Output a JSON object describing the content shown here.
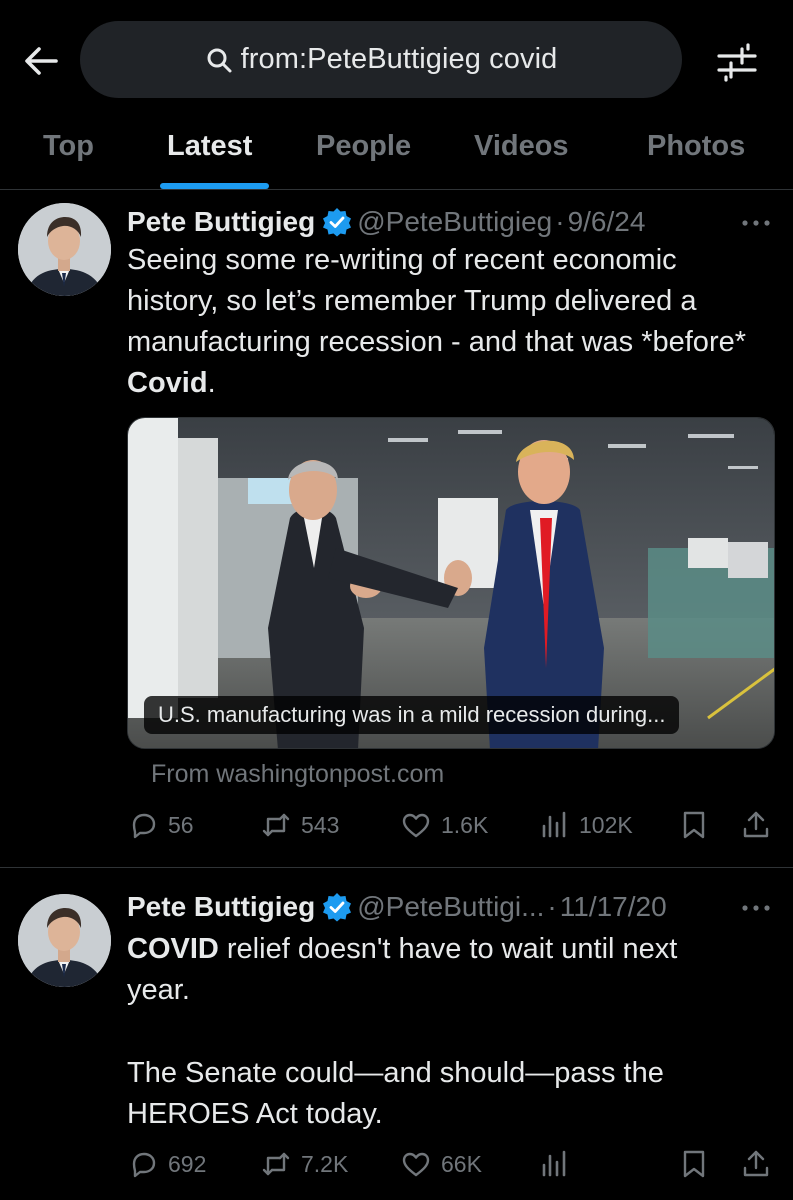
{
  "search": {
    "query": "from:PeteButtigieg covid"
  },
  "tabs": [
    {
      "label": "Top"
    },
    {
      "label": "Latest"
    },
    {
      "label": "People"
    },
    {
      "label": "Videos"
    },
    {
      "label": "Photos"
    }
  ],
  "active_tab": "Latest",
  "tweets": [
    {
      "author": "Pete Buttigieg",
      "handle": "@PeteButtigieg",
      "separator": "·",
      "date": "9/6/24",
      "text_before": "Seeing some re-writing of recent economic history, so let’s remember Trump delivered a manufacturing recession - and that was *before* ",
      "text_bold": "Covid",
      "text_after": ".",
      "card": {
        "caption": "U.S. manufacturing was in a mild recession during...",
        "source": "From washingtonpost.com"
      },
      "stats": {
        "replies": "56",
        "reposts": "543",
        "likes": "1.6K",
        "views": "102K"
      }
    },
    {
      "author": "Pete Buttigieg",
      "handle": "@PeteButtigi...",
      "separator": "·",
      "date": "11/17/20",
      "text_bold": "COVID",
      "text_line1_rest": " relief doesn't have to wait until next year.",
      "text_para2": "The Senate could—and should—pass the HEROES Act today.",
      "stats": {
        "replies": "692",
        "reposts": "7.2K",
        "likes": "66K",
        "views": ""
      }
    }
  ],
  "colors": {
    "background": "#000000",
    "text_primary": "#e7e9ea",
    "text_secondary": "#71767b",
    "accent": "#1d9bf0",
    "search_fill": "#202327",
    "divider": "#2f3336"
  },
  "icons": [
    "back-arrow-icon",
    "search-icon",
    "filter-sliders-icon",
    "verified-badge-icon",
    "more-dots-icon",
    "reply-icon",
    "repost-icon",
    "like-icon",
    "views-icon",
    "bookmark-icon",
    "share-icon"
  ]
}
